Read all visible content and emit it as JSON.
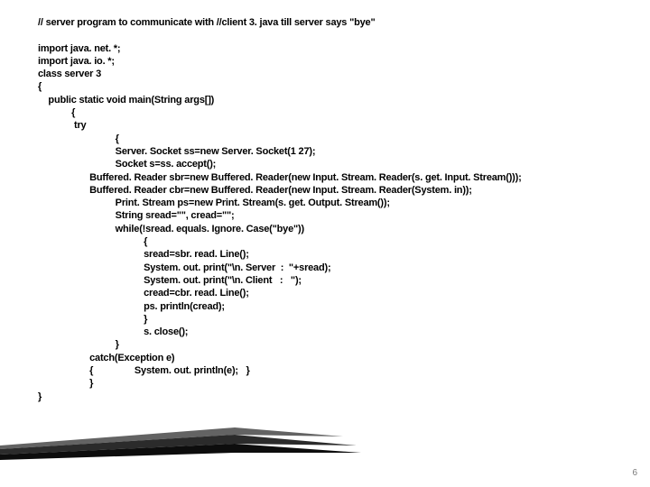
{
  "slide": {
    "page_number": "6",
    "code_lines": [
      "// server program to communicate with //client 3. java till server says \"bye\"",
      "",
      "import java. net. *;",
      "import java. io. *;",
      "class server 3",
      "{",
      "    public static void main(String args[])",
      "             {",
      "              try",
      "                              {",
      "                              Server. Socket ss=new Server. Socket(1 27);",
      "                              Socket s=ss. accept();",
      "                    Buffered. Reader sbr=new Buffered. Reader(new Input. Stream. Reader(s. get. Input. Stream()));",
      "                    Buffered. Reader cbr=new Buffered. Reader(new Input. Stream. Reader(System. in));",
      "                              Print. Stream ps=new Print. Stream(s. get. Output. Stream());",
      "                              String sread=\"\", cread=\"\";",
      "                              while(!sread. equals. Ignore. Case(\"bye\"))",
      "                                         {",
      "                                         sread=sbr. read. Line();",
      "                                         System. out. print(\"\\n. Server  :  \"+sread);",
      "                                         System. out. print(\"\\n. Client   :   \");",
      "                                         cread=cbr. read. Line();",
      "                                         ps. println(cread);",
      "                                         }",
      "                                         s. close();",
      "                              }",
      "                    catch(Exception e)",
      "                    {                System. out. println(e);   }",
      "                    }",
      "}"
    ]
  }
}
